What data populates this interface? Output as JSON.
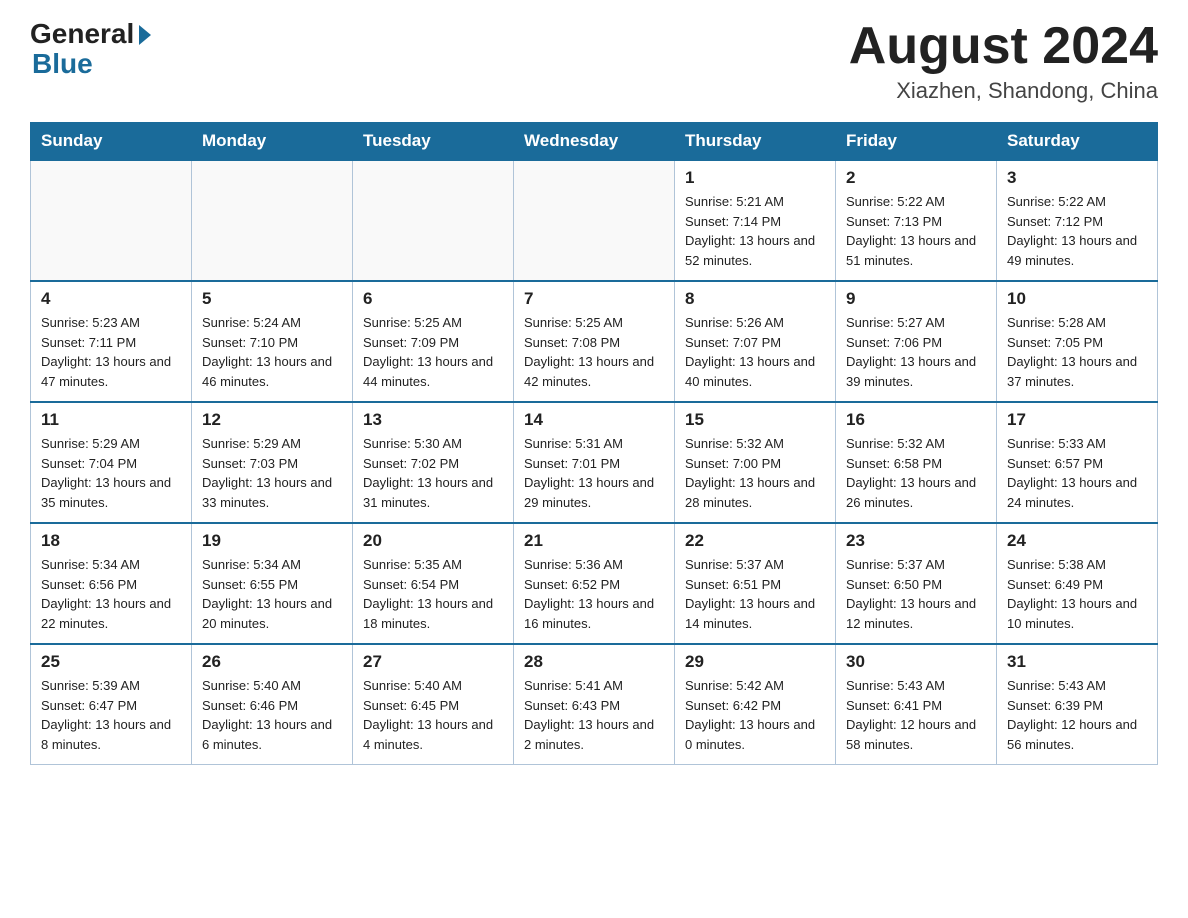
{
  "header": {
    "logo_general": "General",
    "logo_blue": "Blue",
    "month_title": "August 2024",
    "location": "Xiazhen, Shandong, China"
  },
  "weekdays": [
    "Sunday",
    "Monday",
    "Tuesday",
    "Wednesday",
    "Thursday",
    "Friday",
    "Saturday"
  ],
  "weeks": [
    [
      {
        "day": "",
        "info": ""
      },
      {
        "day": "",
        "info": ""
      },
      {
        "day": "",
        "info": ""
      },
      {
        "day": "",
        "info": ""
      },
      {
        "day": "1",
        "info": "Sunrise: 5:21 AM\nSunset: 7:14 PM\nDaylight: 13 hours and 52 minutes."
      },
      {
        "day": "2",
        "info": "Sunrise: 5:22 AM\nSunset: 7:13 PM\nDaylight: 13 hours and 51 minutes."
      },
      {
        "day": "3",
        "info": "Sunrise: 5:22 AM\nSunset: 7:12 PM\nDaylight: 13 hours and 49 minutes."
      }
    ],
    [
      {
        "day": "4",
        "info": "Sunrise: 5:23 AM\nSunset: 7:11 PM\nDaylight: 13 hours and 47 minutes."
      },
      {
        "day": "5",
        "info": "Sunrise: 5:24 AM\nSunset: 7:10 PM\nDaylight: 13 hours and 46 minutes."
      },
      {
        "day": "6",
        "info": "Sunrise: 5:25 AM\nSunset: 7:09 PM\nDaylight: 13 hours and 44 minutes."
      },
      {
        "day": "7",
        "info": "Sunrise: 5:25 AM\nSunset: 7:08 PM\nDaylight: 13 hours and 42 minutes."
      },
      {
        "day": "8",
        "info": "Sunrise: 5:26 AM\nSunset: 7:07 PM\nDaylight: 13 hours and 40 minutes."
      },
      {
        "day": "9",
        "info": "Sunrise: 5:27 AM\nSunset: 7:06 PM\nDaylight: 13 hours and 39 minutes."
      },
      {
        "day": "10",
        "info": "Sunrise: 5:28 AM\nSunset: 7:05 PM\nDaylight: 13 hours and 37 minutes."
      }
    ],
    [
      {
        "day": "11",
        "info": "Sunrise: 5:29 AM\nSunset: 7:04 PM\nDaylight: 13 hours and 35 minutes."
      },
      {
        "day": "12",
        "info": "Sunrise: 5:29 AM\nSunset: 7:03 PM\nDaylight: 13 hours and 33 minutes."
      },
      {
        "day": "13",
        "info": "Sunrise: 5:30 AM\nSunset: 7:02 PM\nDaylight: 13 hours and 31 minutes."
      },
      {
        "day": "14",
        "info": "Sunrise: 5:31 AM\nSunset: 7:01 PM\nDaylight: 13 hours and 29 minutes."
      },
      {
        "day": "15",
        "info": "Sunrise: 5:32 AM\nSunset: 7:00 PM\nDaylight: 13 hours and 28 minutes."
      },
      {
        "day": "16",
        "info": "Sunrise: 5:32 AM\nSunset: 6:58 PM\nDaylight: 13 hours and 26 minutes."
      },
      {
        "day": "17",
        "info": "Sunrise: 5:33 AM\nSunset: 6:57 PM\nDaylight: 13 hours and 24 minutes."
      }
    ],
    [
      {
        "day": "18",
        "info": "Sunrise: 5:34 AM\nSunset: 6:56 PM\nDaylight: 13 hours and 22 minutes."
      },
      {
        "day": "19",
        "info": "Sunrise: 5:34 AM\nSunset: 6:55 PM\nDaylight: 13 hours and 20 minutes."
      },
      {
        "day": "20",
        "info": "Sunrise: 5:35 AM\nSunset: 6:54 PM\nDaylight: 13 hours and 18 minutes."
      },
      {
        "day": "21",
        "info": "Sunrise: 5:36 AM\nSunset: 6:52 PM\nDaylight: 13 hours and 16 minutes."
      },
      {
        "day": "22",
        "info": "Sunrise: 5:37 AM\nSunset: 6:51 PM\nDaylight: 13 hours and 14 minutes."
      },
      {
        "day": "23",
        "info": "Sunrise: 5:37 AM\nSunset: 6:50 PM\nDaylight: 13 hours and 12 minutes."
      },
      {
        "day": "24",
        "info": "Sunrise: 5:38 AM\nSunset: 6:49 PM\nDaylight: 13 hours and 10 minutes."
      }
    ],
    [
      {
        "day": "25",
        "info": "Sunrise: 5:39 AM\nSunset: 6:47 PM\nDaylight: 13 hours and 8 minutes."
      },
      {
        "day": "26",
        "info": "Sunrise: 5:40 AM\nSunset: 6:46 PM\nDaylight: 13 hours and 6 minutes."
      },
      {
        "day": "27",
        "info": "Sunrise: 5:40 AM\nSunset: 6:45 PM\nDaylight: 13 hours and 4 minutes."
      },
      {
        "day": "28",
        "info": "Sunrise: 5:41 AM\nSunset: 6:43 PM\nDaylight: 13 hours and 2 minutes."
      },
      {
        "day": "29",
        "info": "Sunrise: 5:42 AM\nSunset: 6:42 PM\nDaylight: 13 hours and 0 minutes."
      },
      {
        "day": "30",
        "info": "Sunrise: 5:43 AM\nSunset: 6:41 PM\nDaylight: 12 hours and 58 minutes."
      },
      {
        "day": "31",
        "info": "Sunrise: 5:43 AM\nSunset: 6:39 PM\nDaylight: 12 hours and 56 minutes."
      }
    ]
  ]
}
